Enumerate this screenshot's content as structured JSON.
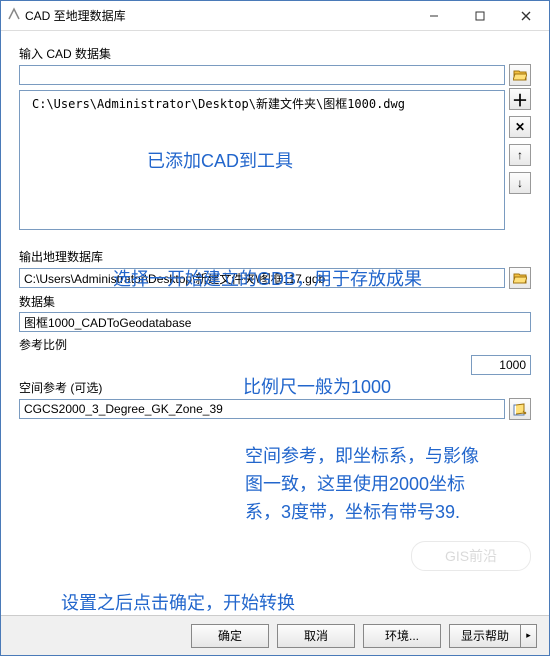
{
  "titlebar": {
    "title": "CAD 至地理数据库"
  },
  "input_cad": {
    "label": "输入 CAD 数据集",
    "value": "",
    "list_item": "C:\\Users\\Administrator\\Desktop\\新建文件夹\\图框1000.dwg"
  },
  "annotations": {
    "added": "已添加CAD到工具",
    "gdb": "选择一开始建立的GDB，用于存放成果",
    "scale": "比例尺一般为1000",
    "spatial": "空间参考，即坐标系，与影像图一致，这里使用2000坐标系，3度带，坐标有带号39.",
    "final": "设置之后点击确定，开始转换"
  },
  "output_gdb": {
    "label": "输出地理数据库",
    "value": "C:\\Users\\Administrator\\Desktop\\新建文件夹\\图框117.gdb"
  },
  "dataset": {
    "label": "数据集",
    "value": "图框1000_CADToGeodatabase"
  },
  "scale": {
    "label": "参考比例",
    "value": "1000"
  },
  "spatial_ref": {
    "label": "空间参考 (可选)",
    "value": "CGCS2000_3_Degree_GK_Zone_39"
  },
  "footer": {
    "ok": "确定",
    "cancel": "取消",
    "env": "环境...",
    "help": "显示帮助"
  },
  "icons": {
    "plus": "＋",
    "remove": "✕",
    "up": "↑",
    "down": "↓"
  },
  "watermark": "GIS前沿"
}
